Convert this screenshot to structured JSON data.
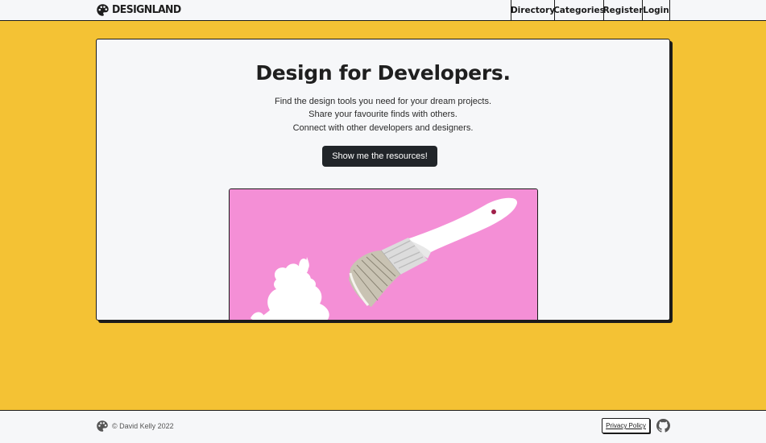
{
  "header": {
    "brand": "DESIGNLAND",
    "nav": [
      "Directory",
      "Categories",
      "Register",
      "Login"
    ]
  },
  "hero": {
    "title": "Design for Developers.",
    "lines": [
      "Find the design tools you need for your dream projects.",
      "Share your favourite finds with others.",
      "Connect with other developers and designers."
    ],
    "cta": "Show me the resources!"
  },
  "footer": {
    "copyright": "© David Kelly 2022",
    "privacy": "Privacy Policy"
  },
  "colors": {
    "page_bg": "#f4c234",
    "surface": "#f6f7f9",
    "button": "#212529",
    "image_bg": "#f48fd6"
  },
  "icons": {
    "logo": "palette-icon",
    "github": "github-icon"
  }
}
